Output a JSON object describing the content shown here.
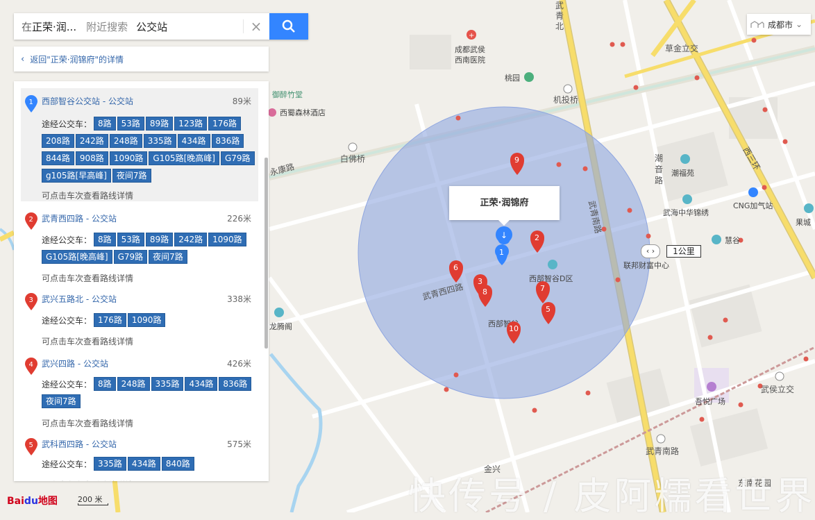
{
  "search": {
    "scope_prefix": "在",
    "scope_name": "正荣·润...",
    "nearby_hint": "附近搜索",
    "query": "公交站"
  },
  "back_link": "返回\"正荣·润锦府\"的详情",
  "city": "成都市",
  "info_window_title": "正荣·润锦府",
  "scale_label": "200 米",
  "km_label": "1公里",
  "logo_text": "Bai地图",
  "watermark": "快传号 / 皮阿糯看世界",
  "results": [
    {
      "index": "1",
      "title": "西部智谷公交站 - 公交站",
      "distance": "89米",
      "route_label": "途经公交车：",
      "routes": [
        "8路",
        "53路",
        "89路",
        "123路",
        "176路",
        "208路",
        "242路",
        "248路",
        "335路",
        "434路",
        "836路",
        "844路",
        "908路",
        "1090路",
        "G105路[晚高峰]",
        "G79路",
        "g105路[早高峰]",
        "夜间7路"
      ],
      "more": "可点击车次查看路线详情",
      "active": true
    },
    {
      "index": "2",
      "title": "武青西四路 - 公交站",
      "distance": "226米",
      "route_label": "途经公交车：",
      "routes": [
        "8路",
        "53路",
        "89路",
        "242路",
        "1090路",
        "G105路[晚高峰]",
        "G79路",
        "夜间7路"
      ],
      "more": "可点击车次查看路线详情",
      "active": false
    },
    {
      "index": "3",
      "title": "武兴五路北 - 公交站",
      "distance": "338米",
      "route_label": "途经公交车：",
      "routes": [
        "176路",
        "1090路"
      ],
      "more": "可点击车次查看路线详情",
      "active": false
    },
    {
      "index": "4",
      "title": "武兴四路 - 公交站",
      "distance": "426米",
      "route_label": "途经公交车：",
      "routes": [
        "8路",
        "248路",
        "335路",
        "434路",
        "836路",
        "夜间7路"
      ],
      "more": "可点击车次查看路线详情",
      "active": false
    },
    {
      "index": "5",
      "title": "武科西四路 - 公交站",
      "distance": "575米",
      "route_label": "途经公交车：",
      "routes": [
        "335路",
        "434路",
        "840路"
      ],
      "more": "可点击车次查看路线详情",
      "active": false
    }
  ],
  "map_labels": {
    "roads": [
      "武青北路",
      "永康路",
      "武青南路",
      "西三环",
      "潮音路",
      "武青西四路",
      "金兴",
      "草金立交",
      "机投桥",
      "白佛桥",
      "武侯立交",
      "武青南路"
    ],
    "pois": [
      "成都武侯西南医院",
      "桃园",
      "御醉竹堂",
      "西蜀森林酒店",
      "潮福苑",
      "武海中华锦绣",
      "CNG加气站",
      "慧谷",
      "联邦财富中心",
      "西部智谷D区",
      "西部智谷",
      "龙腾阁",
      "吾悦广场",
      "果城",
      "东南花园"
    ]
  },
  "map_markers": [
    "1",
    "2",
    "3",
    "5",
    "6",
    "7",
    "8",
    "9",
    "10"
  ],
  "colors": {
    "accent": "#3385ff",
    "marker_red": "#e03c31",
    "marker_blue": "#3385ff",
    "route_badge": "#2f6db4",
    "radius_fill": "#8fa6e0"
  }
}
